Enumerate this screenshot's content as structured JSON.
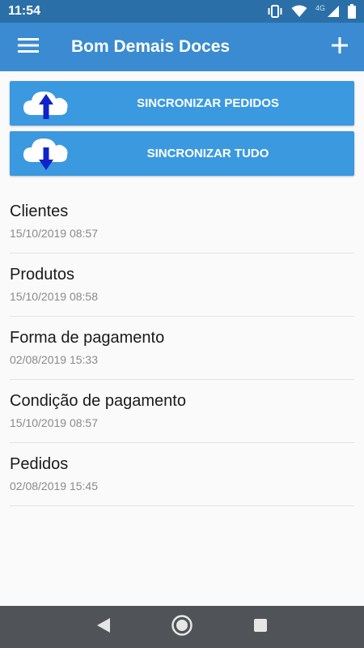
{
  "status_bar": {
    "time": "11:54",
    "network_label": "4G",
    "icons": [
      "vibrate-icon",
      "wifi-icon",
      "signal-icon",
      "battery-icon"
    ]
  },
  "toolbar": {
    "title": "Bom Demais Doces",
    "menu_icon": "hamburger-menu-icon",
    "add_icon": "plus-icon"
  },
  "actions": {
    "sync_orders_label": "SINCRONIZAR PEDIDOS",
    "sync_all_label": "SINCRONIZAR TUDO",
    "upload_icon": "cloud-upload-icon",
    "download_icon": "cloud-download-icon"
  },
  "sync_list": [
    {
      "title": "Clientes",
      "date": "15/10/2019 08:57"
    },
    {
      "title": "Produtos",
      "date": "15/10/2019 08:58"
    },
    {
      "title": "Forma de pagamento",
      "date": "02/08/2019 15:33"
    },
    {
      "title": "Condição de pagamento",
      "date": "15/10/2019 08:57"
    },
    {
      "title": "Pedidos",
      "date": "02/08/2019 15:45"
    }
  ],
  "colors": {
    "status_bar": "#2b6fa8",
    "toolbar": "#3a8bd1",
    "button": "#3b99e0",
    "arrow": "#1023c8",
    "nav_bar": "#505357"
  }
}
